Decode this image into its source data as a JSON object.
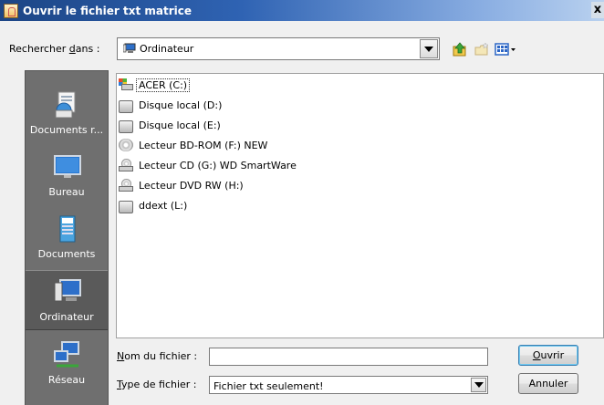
{
  "window": {
    "title": "Ouvrir le fichier txt matrice",
    "close_glyph": "x"
  },
  "lookin": {
    "label_prefix": "Rechercher ",
    "label_mnemonic": "d",
    "label_suffix": "ans :",
    "value": "Ordinateur",
    "icon": "computer-icon"
  },
  "toolbar": {
    "up_icon": "up-folder-icon",
    "new_folder_icon": "new-folder-icon",
    "view_icon": "view-menu-icon"
  },
  "places": [
    {
      "label": "Documents r...",
      "icon": "recent-documents-icon",
      "selected": false
    },
    {
      "label": "Bureau",
      "icon": "desktop-icon",
      "selected": false
    },
    {
      "label": "Documents",
      "icon": "documents-icon",
      "selected": false
    },
    {
      "label": "Ordinateur",
      "icon": "computer-icon",
      "selected": true
    },
    {
      "label": "Réseau",
      "icon": "network-icon",
      "selected": false
    }
  ],
  "files": [
    {
      "name": "ACER (C:)",
      "icon": "windows-drive-icon"
    },
    {
      "name": "Disque local (D:)",
      "icon": "hard-drive-icon"
    },
    {
      "name": "Disque local (E:)",
      "icon": "hard-drive-icon"
    },
    {
      "name": "Lecteur BD-ROM (F:) NEW",
      "icon": "optical-disc-icon"
    },
    {
      "name": "Lecteur CD (G:) WD SmartWare",
      "icon": "cd-drive-icon"
    },
    {
      "name": "Lecteur DVD RW (H:)",
      "icon": "dvd-drive-icon"
    },
    {
      "name": "ddext (L:)",
      "icon": "hard-drive-icon"
    }
  ],
  "filename": {
    "label_mnemonic": "N",
    "label_rest": "om du fichier :",
    "value": ""
  },
  "filetype": {
    "label_mnemonic": "T",
    "label_rest": "ype de fichier :",
    "value": "Fichier txt seulement!"
  },
  "buttons": {
    "open_mnemonic": "O",
    "open_rest": "uvrir",
    "cancel": "Annuler"
  }
}
